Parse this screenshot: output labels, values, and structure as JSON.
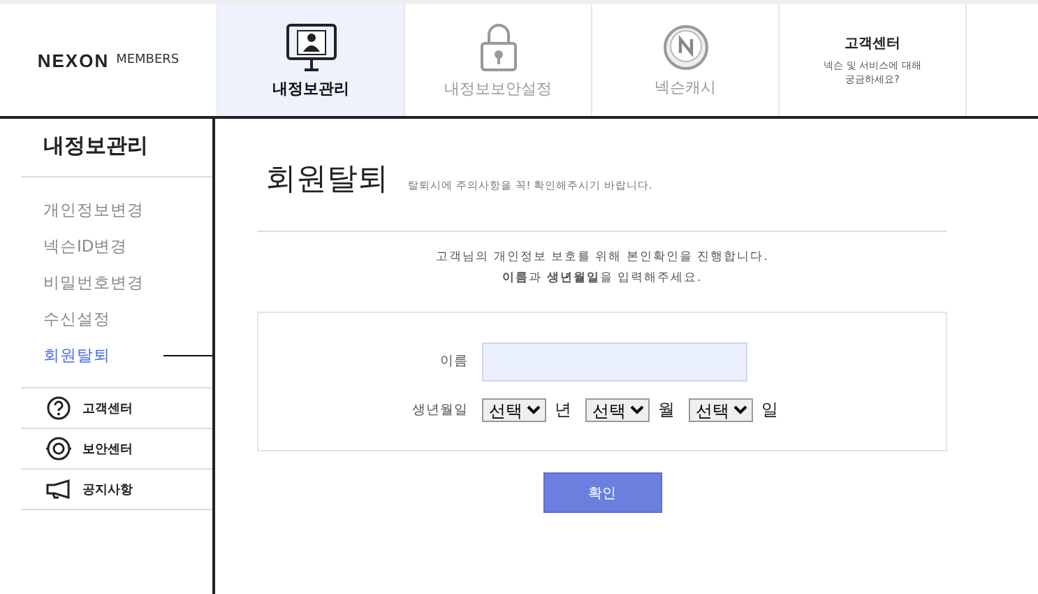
{
  "logo": {
    "brand": "NEXON",
    "suffix": "MEMBERS"
  },
  "tabs": [
    {
      "kind": "monitor",
      "label": "내정보관리",
      "selected": true
    },
    {
      "kind": "lock",
      "label": "내정보보안설정",
      "selected": false
    },
    {
      "kind": "coin",
      "label": "넥슨캐시",
      "selected": false
    },
    {
      "kind": "text",
      "label": "고객센터",
      "sub": "넥슨 및 서비스에 대해\n궁금하세요?",
      "selected": false
    }
  ],
  "sidebar": {
    "title": "내정보관리",
    "items": [
      {
        "label": "개인정보변경",
        "selected": false
      },
      {
        "label": "넥슨ID변경",
        "selected": false
      },
      {
        "label": "비밀번호변경",
        "selected": false
      },
      {
        "label": "수신설정",
        "selected": false
      },
      {
        "label": "회원탈퇴",
        "selected": true
      }
    ],
    "links": [
      {
        "kind": "help",
        "label": "고객센터"
      },
      {
        "kind": "target",
        "label": "보안센터"
      },
      {
        "kind": "megaphone",
        "label": "공지사항"
      }
    ]
  },
  "page": {
    "title": "회원탈퇴",
    "subtitle": "탈퇴시에 주의사항을 꼭! 확인해주시기 바랍니다.",
    "intro": [
      "고객님의 개인정보 보호를 위해 본인확인을 진행합니다.",
      "**이름**과 **생년월일**을 입력해주세요."
    ],
    "name_label": "이름",
    "birth_label": "생년월일",
    "selects": [
      {
        "value": "선택",
        "unit": "년"
      },
      {
        "value": "선택",
        "unit": "월"
      },
      {
        "value": "선택",
        "unit": "일"
      }
    ],
    "confirm": "확인"
  }
}
